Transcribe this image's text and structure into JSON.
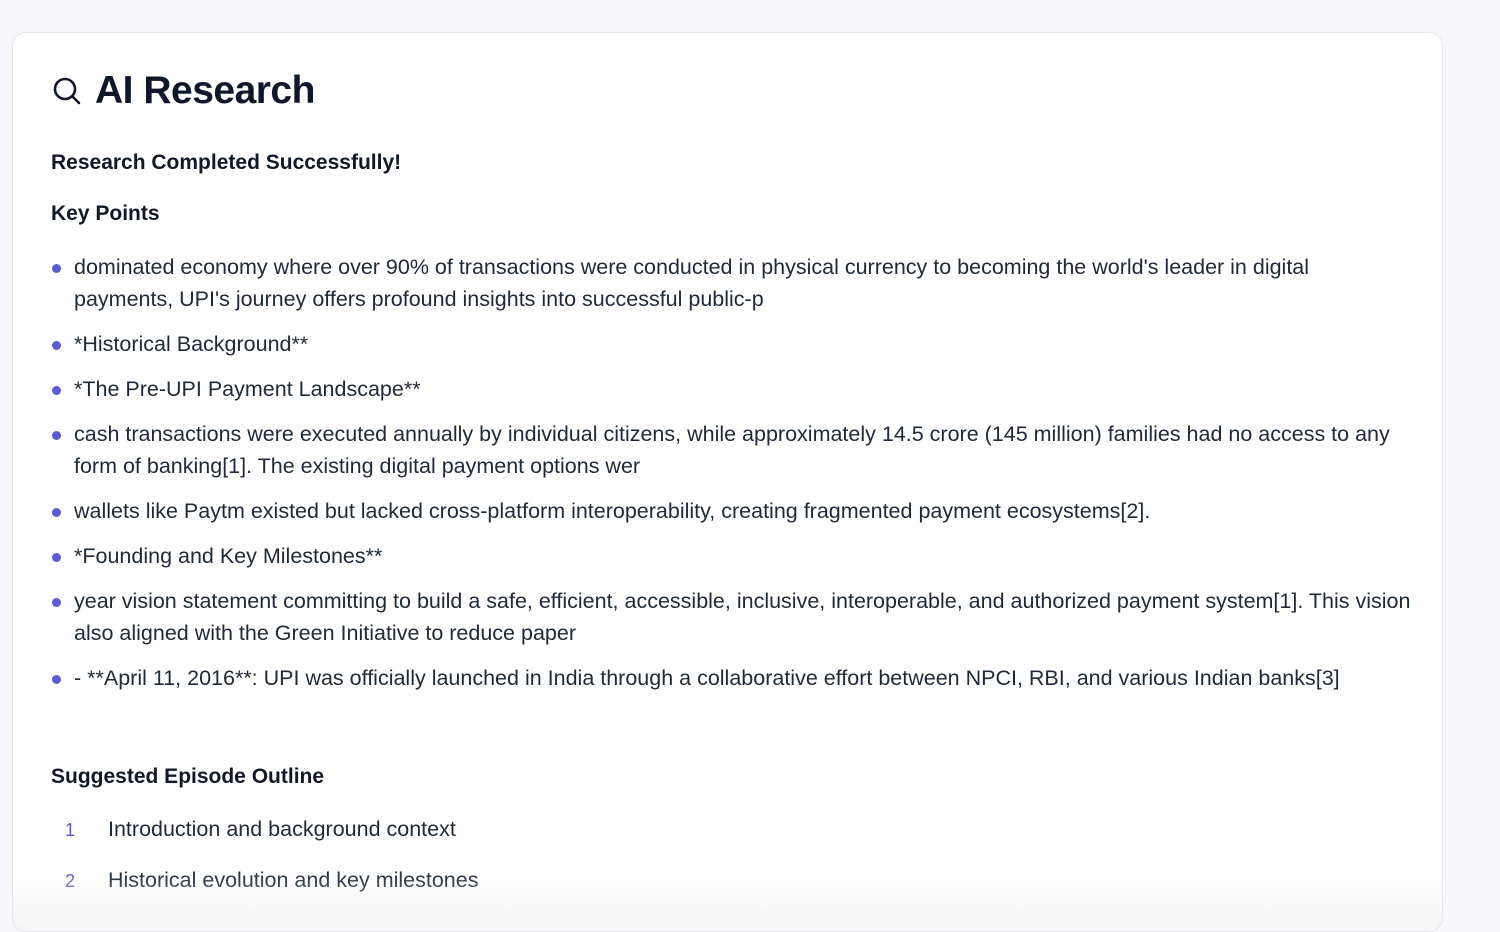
{
  "panel": {
    "title": "AI Research",
    "icon": "search-icon",
    "status": "Research Completed Successfully!"
  },
  "key_points": {
    "heading": "Key Points",
    "items": [
      "dominated economy where over 90% of transactions were conducted in physical currency to becoming the world's leader in digital payments, UPI's journey offers profound insights into successful public-p",
      "*Historical Background**",
      "*The Pre-UPI Payment Landscape**",
      "cash transactions were executed annually by individual citizens, while approximately 14.5 crore (145 million) families had no access to any form of banking[1]. The existing digital payment options wer",
      "wallets like Paytm existed but lacked cross-platform interoperability, creating fragmented payment ecosystems[2].",
      "*Founding and Key Milestones**",
      "year vision statement committing to build a safe, efficient, accessible, inclusive, interoperable, and authorized payment system[1]. This vision also aligned with the Green Initiative to reduce paper",
      "- **April 11, 2016**: UPI was officially launched in India through a collaborative effort between NPCI, RBI, and various Indian banks[3]"
    ]
  },
  "outline": {
    "heading": "Suggested Episode Outline",
    "items": [
      {
        "num": "1",
        "text": "Introduction and background context"
      },
      {
        "num": "2",
        "text": "Historical evolution and key milestones"
      }
    ]
  },
  "colors": {
    "accent": "#5b5bd6",
    "text": "#1f2937",
    "heading": "#0f172a"
  }
}
